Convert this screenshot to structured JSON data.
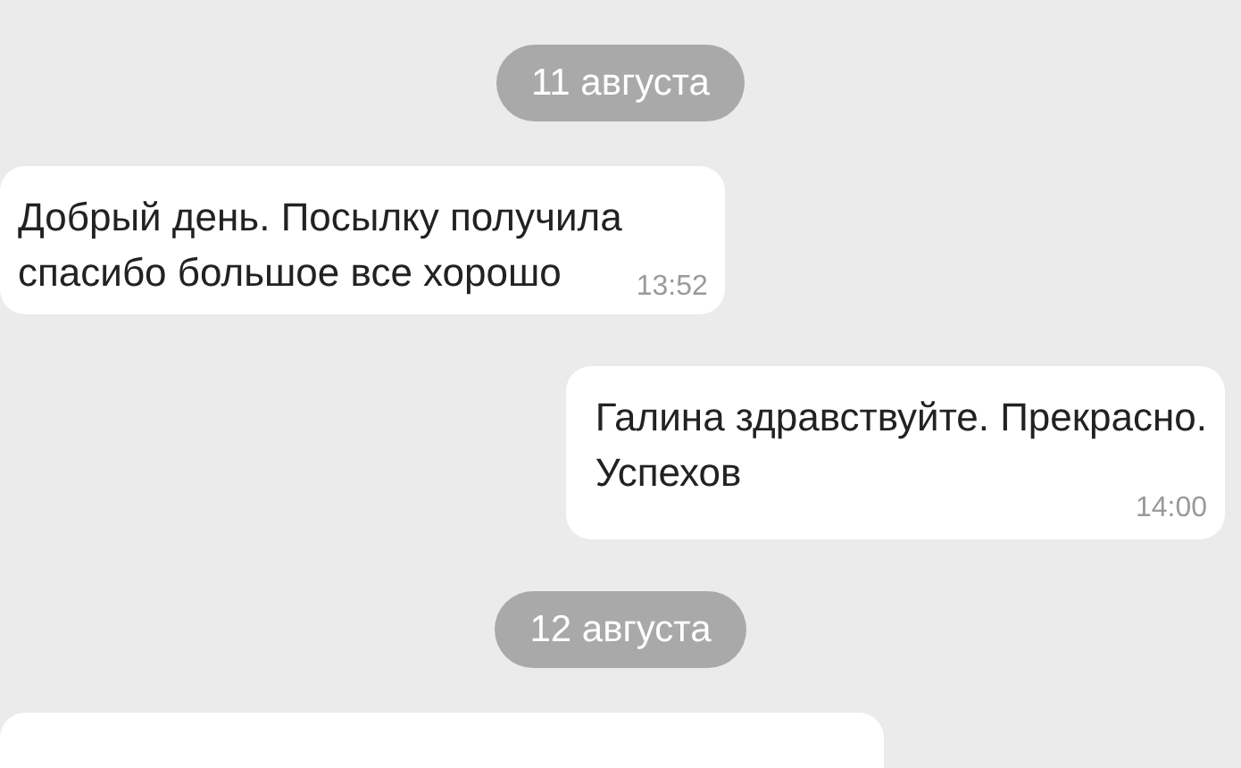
{
  "messages": [
    {
      "kind": "date",
      "text": "11 августа"
    },
    {
      "kind": "incoming",
      "lines": [
        "Добрый день. Посылку получила",
        "спасибо большое все хорошо"
      ],
      "time": "13:52"
    },
    {
      "kind": "outgoing",
      "lines": [
        "Галина здравствуйте.  Прекрасно.",
        "Успехов"
      ],
      "time": "14:00"
    },
    {
      "kind": "date",
      "text": "12 августа"
    },
    {
      "kind": "incoming"
    }
  ]
}
